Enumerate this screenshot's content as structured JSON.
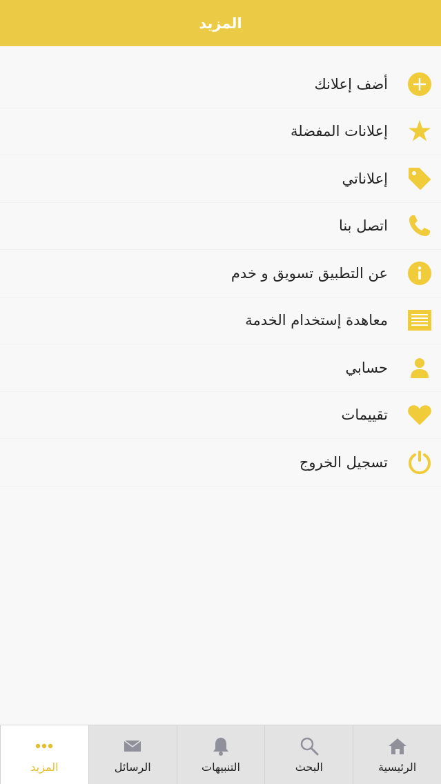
{
  "colors": {
    "accent": "#ebca45",
    "icon": "#f0cb3a",
    "tab_icon": "#8f909a",
    "active_tab": "#e2bf2f"
  },
  "header": {
    "title": "المزيد"
  },
  "menu": {
    "items": [
      {
        "label": "أضف إعلانك",
        "icon": "plus-circle-icon"
      },
      {
        "label": "إعلانات المفضلة",
        "icon": "star-icon"
      },
      {
        "label": "إعلاناتي",
        "icon": "tag-icon"
      },
      {
        "label": "اتصل بنا",
        "icon": "phone-icon"
      },
      {
        "label": "عن التطبيق تسويق و خدم",
        "icon": "info-icon"
      },
      {
        "label": "معاهدة إستخدام الخدمة",
        "icon": "document-icon"
      },
      {
        "label": "حسابي",
        "icon": "user-icon"
      },
      {
        "label": "تقييمات",
        "icon": "heart-icon"
      },
      {
        "label": "تسجيل الخروج",
        "icon": "power-icon"
      }
    ]
  },
  "tabbar": {
    "active": "more",
    "tabs": [
      {
        "id": "home",
        "label": "الرئيسية",
        "icon": "home-icon"
      },
      {
        "id": "search",
        "label": "البحث",
        "icon": "search-icon"
      },
      {
        "id": "notifications",
        "label": "التنبيهات",
        "icon": "bell-icon"
      },
      {
        "id": "messages",
        "label": "الرسائل",
        "icon": "envelope-icon"
      },
      {
        "id": "more",
        "label": "المزيد",
        "icon": "more-dots-icon"
      }
    ]
  }
}
